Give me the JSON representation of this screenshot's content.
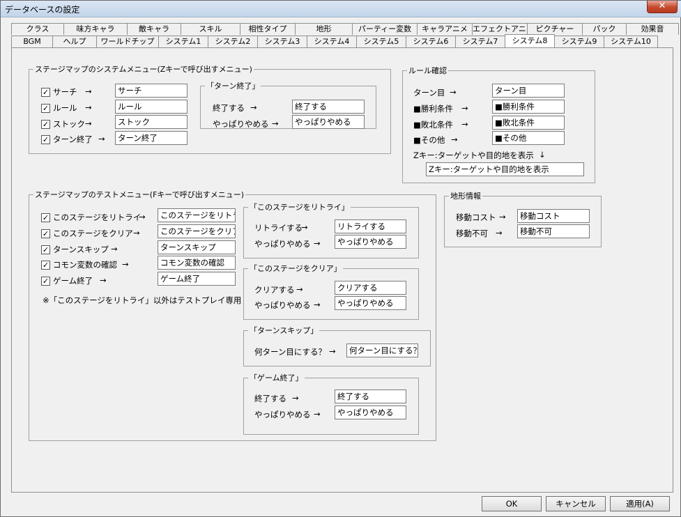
{
  "window": {
    "title": "データベースの設定"
  },
  "tabs_row1": [
    "クラス",
    "味方キャラ",
    "敵キャラ",
    "スキル",
    "相性タイプ",
    "地形",
    "パーティー変数",
    "キャラアニメ",
    "エフェクトアニメ",
    "ピクチャー",
    "パック",
    "効果音"
  ],
  "tabs_row2": [
    "BGM",
    "ヘルプ",
    "ワールドチップ",
    "システム1",
    "システム2",
    "システム3",
    "システム4",
    "システム5",
    "システム6",
    "システム7",
    "システム8",
    "システム9",
    "システム10"
  ],
  "active_tab": "システム8",
  "sysmenu": {
    "legend": "ステージマップのシステムメニュー(Zキーで呼び出すメニュー)",
    "items": [
      {
        "label": "サーチ",
        "arrow": "→",
        "value": "サーチ"
      },
      {
        "label": "ルール",
        "arrow": "→",
        "value": "ルール"
      },
      {
        "label": "ストック",
        "arrow": "→",
        "value": "ストック"
      },
      {
        "label": "ターン終了",
        "arrow": "→",
        "value": "ターン終了"
      }
    ],
    "turnend": {
      "legend": "「ターン終了」",
      "items": [
        {
          "label": "終了する",
          "arrow": "→",
          "value": "終了する"
        },
        {
          "label": "やっぱりやめる",
          "arrow": "→",
          "value": "やっぱりやめる"
        }
      ]
    }
  },
  "rules": {
    "legend": "ルール確認",
    "items": [
      {
        "label": "ターン目",
        "arrow": "→",
        "value": "ターン目"
      },
      {
        "label": "■勝利条件",
        "arrow": "→",
        "value": "■勝利条件"
      },
      {
        "label": "■敗北条件",
        "arrow": "→",
        "value": "■敗北条件"
      },
      {
        "label": "■その他",
        "arrow": "→",
        "value": "■その他"
      }
    ],
    "zkey_label": "Zキー:ターゲットや目的地を表示",
    "zkey_arrow": "↓",
    "zkey_value": "Zキー:ターゲットや目的地を表示"
  },
  "testmenu": {
    "legend": "ステージマップのテストメニュー(Fキーで呼び出すメニュー)",
    "items": [
      {
        "label": "このステージをリトライ",
        "arrow": "→",
        "value": "このステージをリトラ-"
      },
      {
        "label": "このステージをクリア",
        "arrow": "→",
        "value": "このステージをクリア"
      },
      {
        "label": "ターンスキップ",
        "arrow": "→",
        "value": "ターンスキップ"
      },
      {
        "label": "コモン変数の確認",
        "arrow": "→",
        "value": "コモン変数の確認"
      },
      {
        "label": "ゲーム終了",
        "arrow": "→",
        "value": "ゲーム終了"
      }
    ],
    "note": "※「このステージをリトライ」以外はテストプレイ専用",
    "retry": {
      "legend": "「このステージをリトライ」",
      "items": [
        {
          "label": "リトライする",
          "arrow": "→",
          "value": "リトライする"
        },
        {
          "label": "やっぱりやめる",
          "arrow": "→",
          "value": "やっぱりやめる"
        }
      ]
    },
    "clear": {
      "legend": "「このステージをクリア」",
      "items": [
        {
          "label": "クリアする",
          "arrow": "→",
          "value": "クリアする"
        },
        {
          "label": "やっぱりやめる",
          "arrow": "→",
          "value": "やっぱりやめる"
        }
      ]
    },
    "skip": {
      "legend": "「ターンスキップ」",
      "items": [
        {
          "label": "何ターン目にする？",
          "arrow": "→",
          "value": "何ターン目にする？"
        }
      ]
    },
    "gameend": {
      "legend": "「ゲーム終了」",
      "items": [
        {
          "label": "終了する",
          "arrow": "→",
          "value": "終了する"
        },
        {
          "label": "やっぱりやめる",
          "arrow": "→",
          "value": "やっぱりやめる"
        }
      ]
    }
  },
  "terrain": {
    "legend": "地形情報",
    "items": [
      {
        "label": "移動コスト",
        "arrow": "→",
        "value": "移動コスト"
      },
      {
        "label": "移動不可",
        "arrow": "→",
        "value": "移動不可"
      }
    ]
  },
  "buttons": {
    "ok": "OK",
    "cancel": "キャンセル",
    "apply": "適用(A)"
  }
}
